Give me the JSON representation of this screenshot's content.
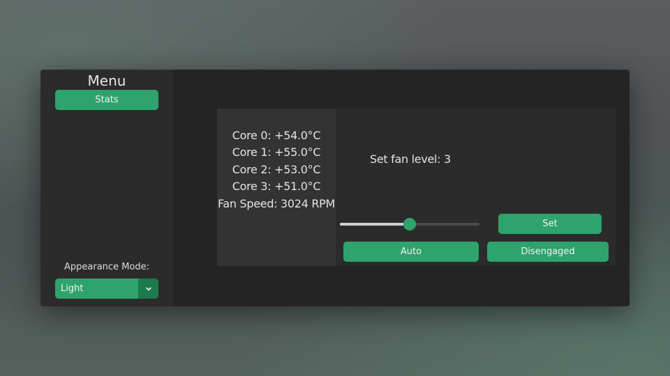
{
  "sidebar": {
    "title": "Menu",
    "stats_button": "Stats",
    "appearance_label": "Appearance Mode:",
    "appearance_value": "Light"
  },
  "stats": {
    "core0": "Core 0: +54.0°C",
    "core1": "Core 1: +55.0°C",
    "core2": "Core 2: +53.0°C",
    "core3": "Core 3: +51.0°C",
    "fan_speed": "Fan Speed: 3024 RPM"
  },
  "controls": {
    "fan_level_label": "Set fan level: 3",
    "slider_fraction": 0.5,
    "set_button": "Set",
    "auto_button": "Auto",
    "disengaged_button": "Disengaged"
  },
  "colors": {
    "accent": "#2ea46c",
    "accent_dark": "#1c7a4c",
    "window_bg": "#242424",
    "sidebar_bg": "#2b2b2b",
    "stats_bg": "#333333"
  },
  "icons": {
    "dropdown": "chevron-down-icon"
  }
}
